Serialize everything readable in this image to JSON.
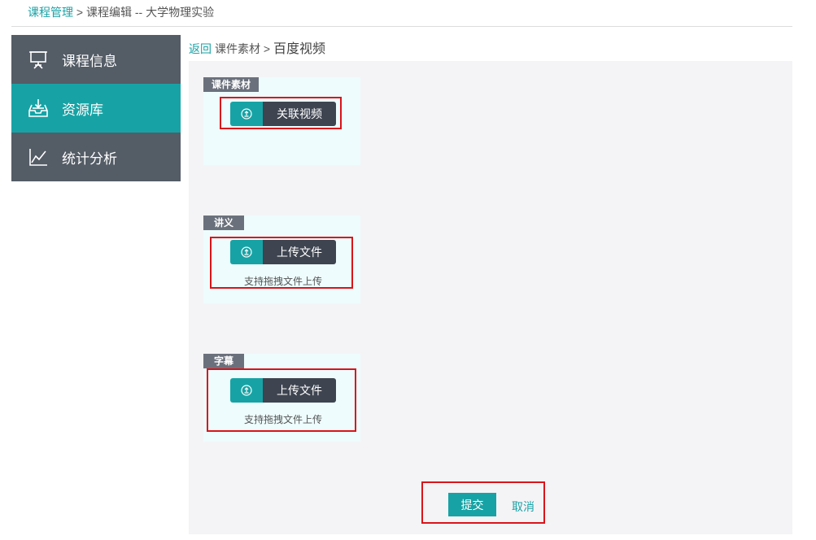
{
  "breadcrumb": {
    "root": "课程管理",
    "separator": " > ",
    "current": "课程编辑 -- 大学物理实验"
  },
  "sidebar": {
    "items": [
      {
        "label": "课程信息",
        "icon": "presentation-board-icon",
        "active": false
      },
      {
        "label": "资源库",
        "icon": "inbox-download-icon",
        "active": true
      },
      {
        "label": "统计分析",
        "icon": "line-chart-icon",
        "active": false
      }
    ]
  },
  "subnav": {
    "back": "返回",
    "parent": "课件素材",
    "separator": " > ",
    "current": "百度视频"
  },
  "sections": [
    {
      "tag": "课件素材",
      "button": "关联视频",
      "button_icon": "upload-circle-icon"
    },
    {
      "tag": "讲义",
      "button": "上传文件",
      "button_icon": "upload-circle-icon",
      "hint": "支持拖拽文件上传"
    },
    {
      "tag": "字幕",
      "button": "上传文件",
      "button_icon": "upload-circle-icon",
      "hint": "支持拖拽文件上传"
    }
  ],
  "actions": {
    "submit": "提交",
    "cancel": "取消"
  },
  "colors": {
    "accent": "#17a3a5",
    "sidebar_bg": "#545c66",
    "button_dark": "#3e4450",
    "highlight_border": "#d9141a",
    "panel_bg": "#eefcfd",
    "content_bg": "#f4f4f6"
  }
}
